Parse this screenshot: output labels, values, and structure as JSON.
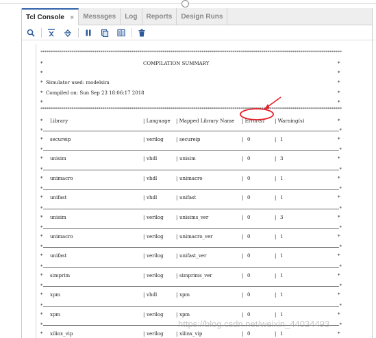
{
  "tabs": [
    {
      "label": "Tcl Console",
      "active": true,
      "closable": true
    },
    {
      "label": "Messages"
    },
    {
      "label": "Log"
    },
    {
      "label": "Reports"
    },
    {
      "label": "Design Runs"
    }
  ],
  "tab_close_glyph": "×",
  "toolbar": {
    "icons": [
      "search-icon",
      "collapse-all-icon",
      "expand-all-icon",
      "pause-icon",
      "copy-icon",
      "columns-icon",
      "delete-icon"
    ]
  },
  "console": {
    "header_title": "COMPILATION SUMMARY",
    "simulator_line": "Simulator used: modelsim",
    "compiled_line": "Compiled on: Sun Sep 23 18:06:17 2018",
    "columns": [
      "Library",
      "| Language",
      "| Mapped Library Name",
      "| Error(s)",
      "| Warning(s)"
    ],
    "rows": [
      {
        "library": "secureip",
        "language": "verilog",
        "mapped": "secureip",
        "errors": "0",
        "warnings": "1"
      },
      {
        "library": "unisim",
        "language": "vhdl",
        "mapped": "unisim",
        "errors": "0",
        "warnings": "3"
      },
      {
        "library": "unimacro",
        "language": "vhdl",
        "mapped": "unimacro",
        "errors": "0",
        "warnings": "1"
      },
      {
        "library": "unifast",
        "language": "vhdl",
        "mapped": "unifast",
        "errors": "0",
        "warnings": "1"
      },
      {
        "library": "unisim",
        "language": "verilog",
        "mapped": "unisims_ver",
        "errors": "0",
        "warnings": "3"
      },
      {
        "library": "unimacro",
        "language": "verilog",
        "mapped": "unimacro_ver",
        "errors": "0",
        "warnings": "1"
      },
      {
        "library": "unifast",
        "language": "verilog",
        "mapped": "unifast_ver",
        "errors": "0",
        "warnings": "1"
      },
      {
        "library": "simprim",
        "language": "verilog",
        "mapped": "simprims_ver",
        "errors": "0",
        "warnings": "1"
      },
      {
        "library": "xpm",
        "language": "vhdl",
        "mapped": "xpm",
        "errors": "0",
        "warnings": "1"
      },
      {
        "library": "xpm",
        "language": "verilog",
        "mapped": "xpm",
        "errors": "0",
        "warnings": "1"
      },
      {
        "library": "xilinx_vip",
        "language": "verilog",
        "mapped": "xilinx_vip",
        "errors": "0",
        "warnings": "1"
      }
    ],
    "cell_separator": "|",
    "border_char": "*"
  },
  "annotation": {
    "color": "#e8202a"
  },
  "watermark": "https://blog.csdn.net/weixin_44034493",
  "colors": {
    "active_tab_accent": "#2f5fa8",
    "icon_blue": "#2d5a9a"
  }
}
